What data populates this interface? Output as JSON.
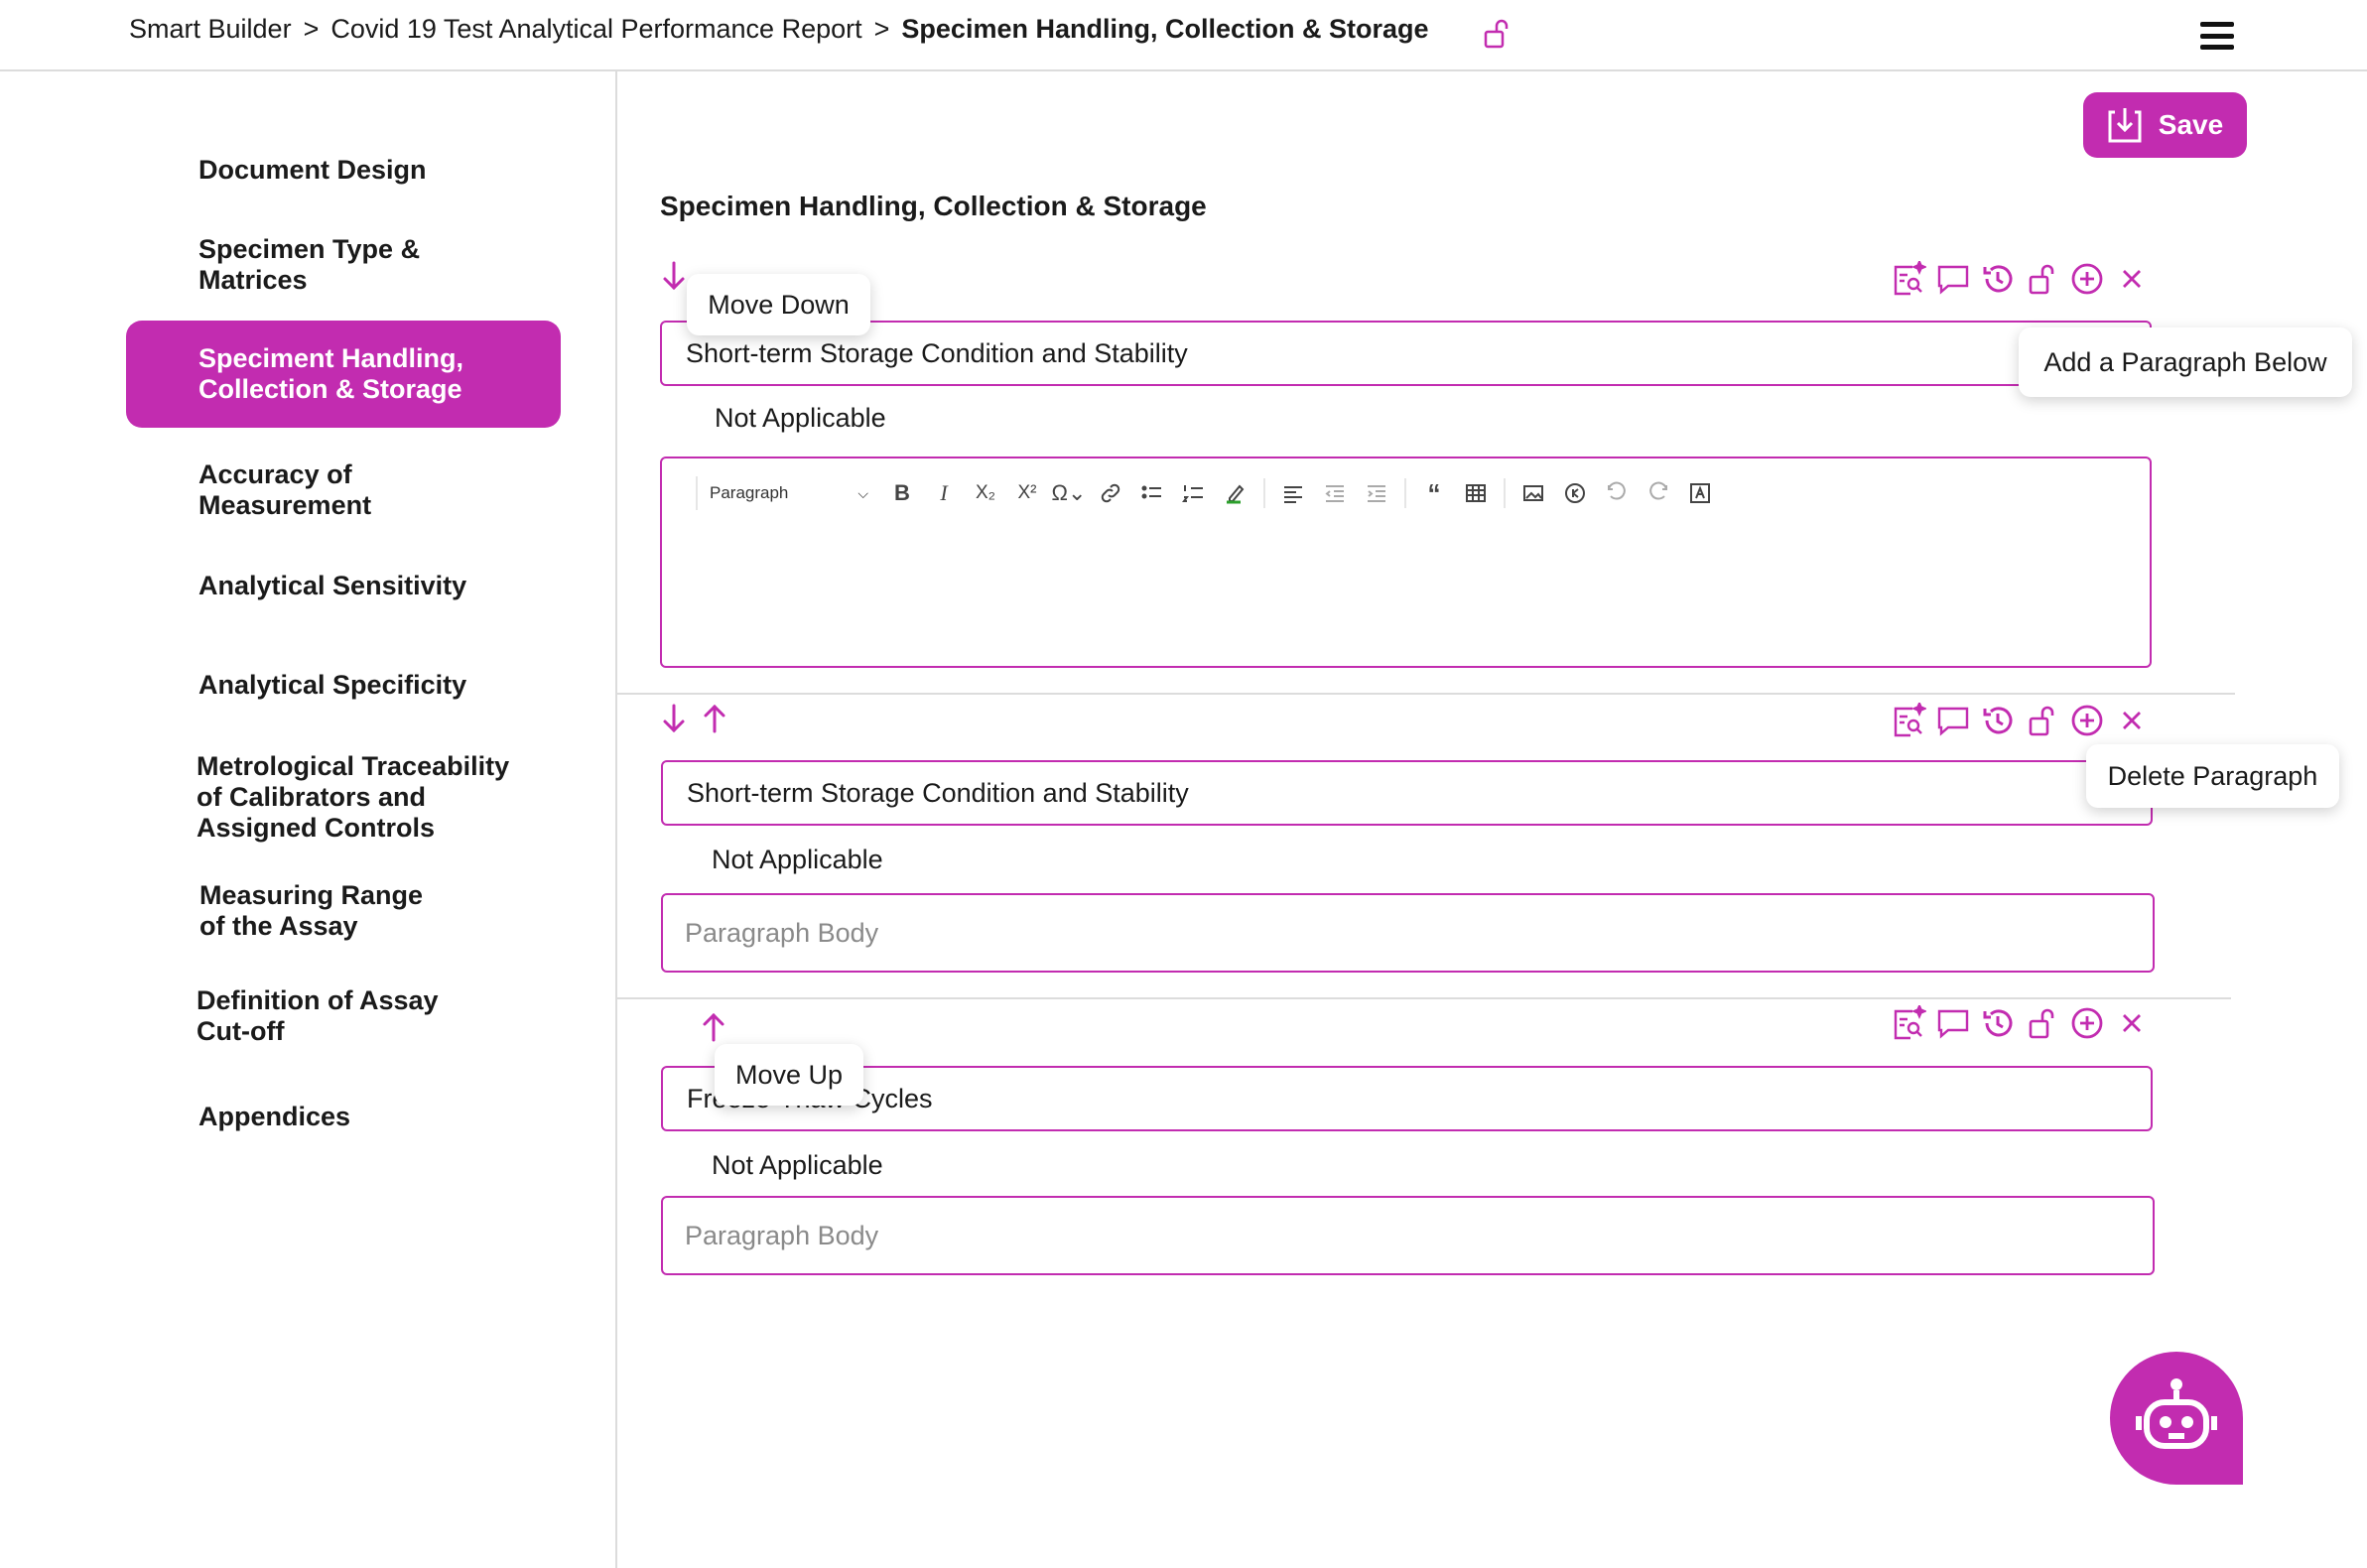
{
  "breadcrumb": {
    "items": [
      "Smart Builder",
      "Covid 19 Test Analytical Performance Report"
    ],
    "separator": ">",
    "current": "Specimen Handling, Collection & Storage"
  },
  "sidebar": {
    "items": [
      {
        "label": "Document Design",
        "active": false
      },
      {
        "label": "Specimen Type & Matrices",
        "active": false
      },
      {
        "label": "Speciment Handling, Collection & Storage",
        "active": true
      },
      {
        "label": "Accuracy of Measurement",
        "active": false
      },
      {
        "label": "Analytical Sensitivity",
        "active": false
      },
      {
        "label": "Analytical Specificity",
        "active": false
      },
      {
        "label": "Metrological Traceability of Calibrators and Assigned Controls",
        "active": false
      },
      {
        "label": "Measuring Range of the Assay",
        "active": false
      },
      {
        "label": "Definition of Assay Cut-off",
        "active": false
      },
      {
        "label": "Appendices",
        "active": false
      }
    ]
  },
  "main": {
    "save_label": "Save",
    "section_title": "Specimen Handling, Collection & Storage",
    "paragraphs": [
      {
        "title": "Short-term Storage Condition and Stability",
        "na_label": "Not Applicable",
        "body_placeholder": ""
      },
      {
        "title": "Short-term Storage Condition and Stability",
        "na_label": "Not Applicable",
        "body_placeholder": "Paragraph Body"
      },
      {
        "title": "Freeze-Thaw Cycles",
        "na_label": "Not Applicable",
        "body_placeholder": "Paragraph Body"
      }
    ],
    "editor": {
      "paragraph_style": "Paragraph"
    }
  },
  "tooltips": {
    "move_down": "Move Down",
    "add_paragraph": "Add a Paragraph Below",
    "delete_paragraph": "Delete Paragraph",
    "move_up": "Move Up"
  },
  "icons": {
    "top_lock": "lock-open-icon",
    "menu": "hamburger-menu-icon",
    "chatbot": "robot-icon"
  },
  "colors": {
    "accent": "#c22cb0",
    "border": "#dcdcdc",
    "placeholder": "#8a8a8a"
  }
}
